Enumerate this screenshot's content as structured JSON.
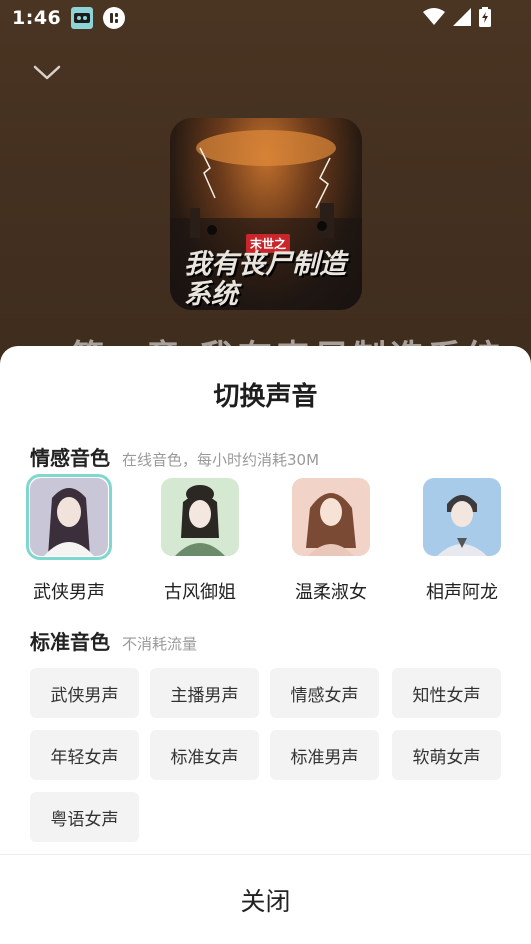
{
  "status_bar": {
    "time": "1:46"
  },
  "player": {
    "cover": {
      "tag": "末世之",
      "title": "我有丧尸制造系统"
    },
    "background_title": "第一章 我有丧尸制造系统"
  },
  "sheet": {
    "title": "切换声音",
    "emotional": {
      "heading": "情感音色",
      "subtitle": "在线音色，每小时约消耗30M",
      "voices": [
        {
          "label": "武侠男声",
          "selected": true,
          "bg": "#c9c6d8"
        },
        {
          "label": "古风御姐",
          "selected": false,
          "bg": "#d5e8d2"
        },
        {
          "label": "温柔淑女",
          "selected": false,
          "bg": "#f1d3c7"
        },
        {
          "label": "相声阿龙",
          "selected": false,
          "bg": "#a9cbea"
        }
      ]
    },
    "standard": {
      "heading": "标准音色",
      "subtitle": "不消耗流量",
      "chips": [
        "武侠男声",
        "主播男声",
        "情感女声",
        "知性女声",
        "年轻女声",
        "标准女声",
        "标准男声",
        "软萌女声",
        "粤语女声"
      ]
    },
    "close_label": "关闭"
  },
  "colors": {
    "selected_border": "#7fd8d0",
    "chip_bg": "#f3f3f3"
  }
}
